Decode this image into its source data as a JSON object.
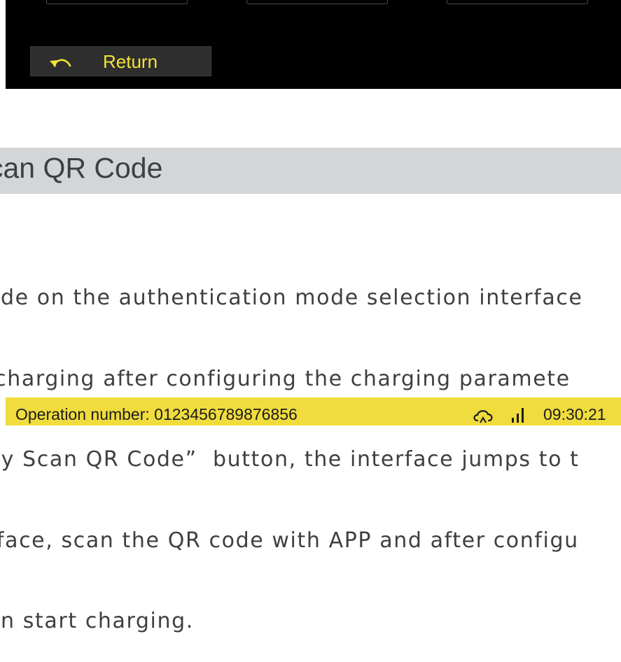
{
  "return_button": {
    "label": "Return",
    "icon": "undo-arrow-icon"
  },
  "section": {
    "title": "can QR Code"
  },
  "body_lines": [
    "ode on the authentication mode selection interface",
    " charging after configuring the charging paramete",
    "by Scan QR Code”  button, the interface jumps to t",
    "rface, scan the QR code with APP and after configu",
    "en start charging."
  ],
  "status_bar": {
    "operation_label": "Operation number:  0123456789876856",
    "time": "09:30:21",
    "icons": [
      "cloud-icon",
      "signal-strength-icon"
    ]
  },
  "colors": {
    "accent_yellow": "#f0dc3c",
    "button_text": "#f2e33a",
    "section_bar": "#d4d5d7",
    "text_gray": "#3d3f42"
  }
}
